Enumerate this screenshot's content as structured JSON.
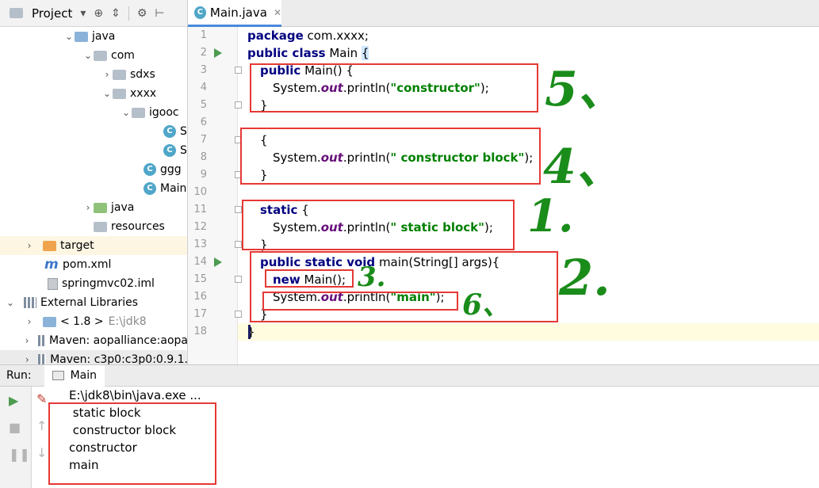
{
  "project_panel": {
    "title": "Project",
    "tree": [
      {
        "label": "java",
        "icon": "folder-blue-icon",
        "expanded": true
      },
      {
        "label": "com",
        "icon": "package-icon",
        "expanded": true
      },
      {
        "label": "sdxs",
        "icon": "package-icon",
        "expanded": false
      },
      {
        "label": "xxxx",
        "icon": "package-icon",
        "expanded": true
      },
      {
        "label": "igooc",
        "icon": "package-icon",
        "expanded": true
      },
      {
        "label": "S",
        "icon": "class-icon"
      },
      {
        "label": "S",
        "icon": "class-icon"
      },
      {
        "label": "ggg",
        "icon": "class-icon"
      },
      {
        "label": "Main",
        "icon": "class-icon"
      },
      {
        "label": "java",
        "icon": "folder-green-icon",
        "expanded": false
      },
      {
        "label": "resources",
        "icon": "resources-folder-icon"
      },
      {
        "label": "target",
        "icon": "folder-orange-icon",
        "expanded": false
      },
      {
        "label": "pom.xml",
        "icon": "maven-icon"
      },
      {
        "label": "springmvc02.iml",
        "icon": "iml-file-icon"
      },
      {
        "label": "External Libraries",
        "icon": "library-icon",
        "expanded": true
      },
      {
        "label": "< 1.8 >",
        "extra": "E:\\jdk8",
        "icon": "jdk-icon",
        "expanded": false
      },
      {
        "label": "Maven: aopalliance:aopa",
        "icon": "library-icon",
        "expanded": false
      },
      {
        "label": "Maven: c3p0:c3p0:0.9.1.",
        "icon": "library-icon",
        "expanded": false
      }
    ]
  },
  "editor": {
    "tab_label": "Main.java",
    "line_numbers": [
      "1",
      "2",
      "3",
      "4",
      "5",
      "6",
      "7",
      "8",
      "9",
      "10",
      "11",
      "12",
      "13",
      "14",
      "15",
      "16",
      "17",
      "18"
    ],
    "code": {
      "l1_kw": "package",
      "l1_rest": " com.xxxx;",
      "l2_kw": "public class",
      "l2_rest": " Main ",
      "l2_brace": "{",
      "l3_kw": "public",
      "l3_rest": " Main() {",
      "l4_pre": "System.",
      "l4_out": "out",
      "l4_mid": ".println(",
      "l4_str": "\"constructor\"",
      "l4_end": ");",
      "l5": "}",
      "l7": "{",
      "l8_pre": "System.",
      "l8_out": "out",
      "l8_mid": ".println(",
      "l8_str": "\" constructor block\"",
      "l8_end": ");",
      "l9": "}",
      "l11_kw": "static",
      "l11_rest": " {",
      "l12_pre": "System.",
      "l12_out": "out",
      "l12_mid": ".println(",
      "l12_str": "\" static block\"",
      "l12_end": ");",
      "l13": "}",
      "l14_kw": "public static void",
      "l14_rest": " main(String[] args){",
      "l15_kw": "new",
      "l15_rest": " Main();",
      "l16_pre": "System.",
      "l16_out": "out",
      "l16_mid": ".println(",
      "l16_str": "\"main\"",
      "l16_end": ");",
      "l17": "}",
      "l18": "}"
    },
    "annotations": [
      "5、",
      "4、",
      "1.",
      "3.",
      "2.",
      "6、"
    ]
  },
  "run_panel": {
    "label": "Run:",
    "tab_label": "Main",
    "output": [
      "E:\\jdk8\\bin\\java.exe ...",
      " static block",
      " constructor block",
      "constructor",
      "main"
    ]
  },
  "colors": {
    "annotation_box": "#e53935",
    "handwriting": "#1a8c1a",
    "keyword": "#000080",
    "string": "#008000",
    "static_field": "#660e7a"
  }
}
